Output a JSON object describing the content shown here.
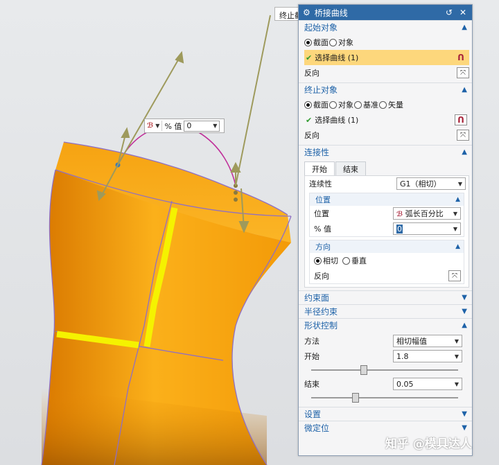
{
  "top_tag": "终止截",
  "float_toolbar": {
    "pct_label": "% 值",
    "pct_value": "0"
  },
  "dialog": {
    "title": "桥接曲线",
    "sections": {
      "start": {
        "title": "起始对象",
        "options": [
          "截面",
          "对象"
        ],
        "selected": "截面",
        "select_curve": "选择曲线 (1)",
        "reverse": "反向"
      },
      "end": {
        "title": "终止对象",
        "options": [
          "截面",
          "对象",
          "基准",
          "矢量"
        ],
        "selected": "截面",
        "select_curve": "选择曲线 (1)",
        "reverse": "反向"
      },
      "continuity": {
        "title": "连接性",
        "tabs": [
          "开始",
          "结束"
        ],
        "continuity_label": "连续性",
        "continuity_value": "G1（相切）",
        "position": {
          "title": "位置",
          "position_label": "位置",
          "position_value": "弧长百分比",
          "pct_label": "% 值",
          "pct_value": "0"
        },
        "direction": {
          "title": "方向",
          "options": [
            "相切",
            "垂直"
          ],
          "selected": "相切",
          "reverse": "反向"
        }
      },
      "constraint_face": {
        "title": "约束面"
      },
      "radius_constraint": {
        "title": "半径约束"
      },
      "shape_control": {
        "title": "形状控制",
        "method_label": "方法",
        "method_value": "相切幅值",
        "start_label": "开始",
        "start_value": "1.8",
        "start_slider": 0.36,
        "end_label": "结束",
        "end_value": "0.05",
        "end_slider": 0.3
      },
      "settings": {
        "title": "设置"
      },
      "fine_position": {
        "title": "微定位"
      }
    }
  },
  "watermark": "知乎 @模具达人",
  "colors": {
    "surface": "#f8a815",
    "accent_blue": "#2f6aa6",
    "highlight": "#fdd77c",
    "curve": "#c0309a"
  }
}
